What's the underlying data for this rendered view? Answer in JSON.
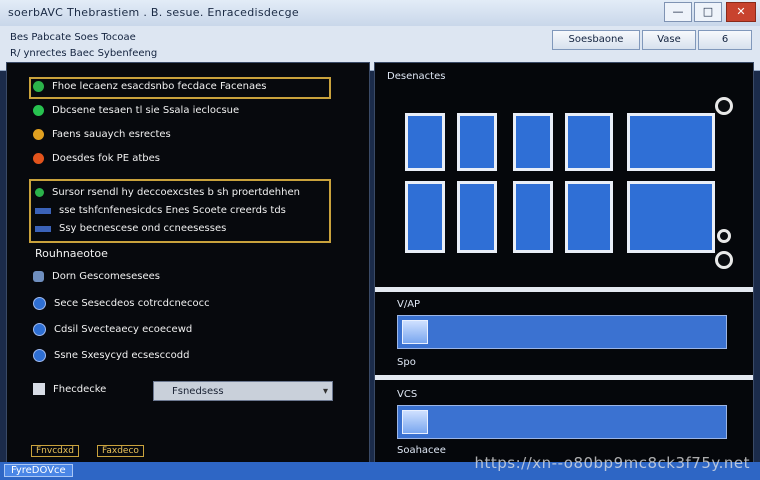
{
  "window": {
    "title": "soerbAVC  Thebrastiem  . B. sesue.  Enracedisdecge",
    "controls": [
      "—",
      "□",
      "✕"
    ]
  },
  "toolbar": {
    "line1": "Bes Pabcate   Soes Tocoae",
    "line2": "R/ ynrectes  Baec  Sybenfeeng",
    "buttons": [
      "Soesbaone",
      "Vase",
      "6"
    ]
  },
  "left": {
    "items": [
      {
        "label": "Fhoe lecaenz esacdsnbo fecdace Facenaes",
        "color": "#2bb24a"
      },
      {
        "label": "Dbcsene tesaen tl sie Ssala ieclocsue",
        "color": "#27c24f"
      },
      {
        "label": "Faens sauaych esrectes",
        "color": "#e0a020"
      },
      {
        "label": "Doesdes fok PE atbes",
        "color": "#e3541c"
      }
    ],
    "detail_lines": [
      "Sursor rsendl  hy  deccoexcstes  b  sh proertdehhen",
      "sse tshfcnfenesicdcs Enes Scoete creerds tds",
      "Ssy  becnescese ond  ccneesesses"
    ],
    "section_title": "Rouhnaeotoe",
    "options": [
      {
        "label": "Dorn  Gescomesesees",
        "selected": false
      },
      {
        "label": "Sece  Sesecdeos  cotrcdcnecocc",
        "selected": true
      },
      {
        "label": "Cdsil  Svecteaecy  ecoecewd",
        "selected": false
      },
      {
        "label": "Ssne  Sxesycyd  ecsesccodd",
        "selected": false
      }
    ],
    "field_label": "Fhecdecke",
    "dropdown_value": "Fsnedsess",
    "footer_buttons": [
      "Fnvcdxd",
      "Faxdeco"
    ]
  },
  "right": {
    "label": "Desenactes",
    "section1_label": "V/AP",
    "section1_caption": "Spo",
    "section2_label": "VCS",
    "section2_caption": "Soahacee"
  },
  "status": {
    "text": "FyreDOVce"
  },
  "watermark": "https://xn--o80bp9mc8ck3f75y.net"
}
